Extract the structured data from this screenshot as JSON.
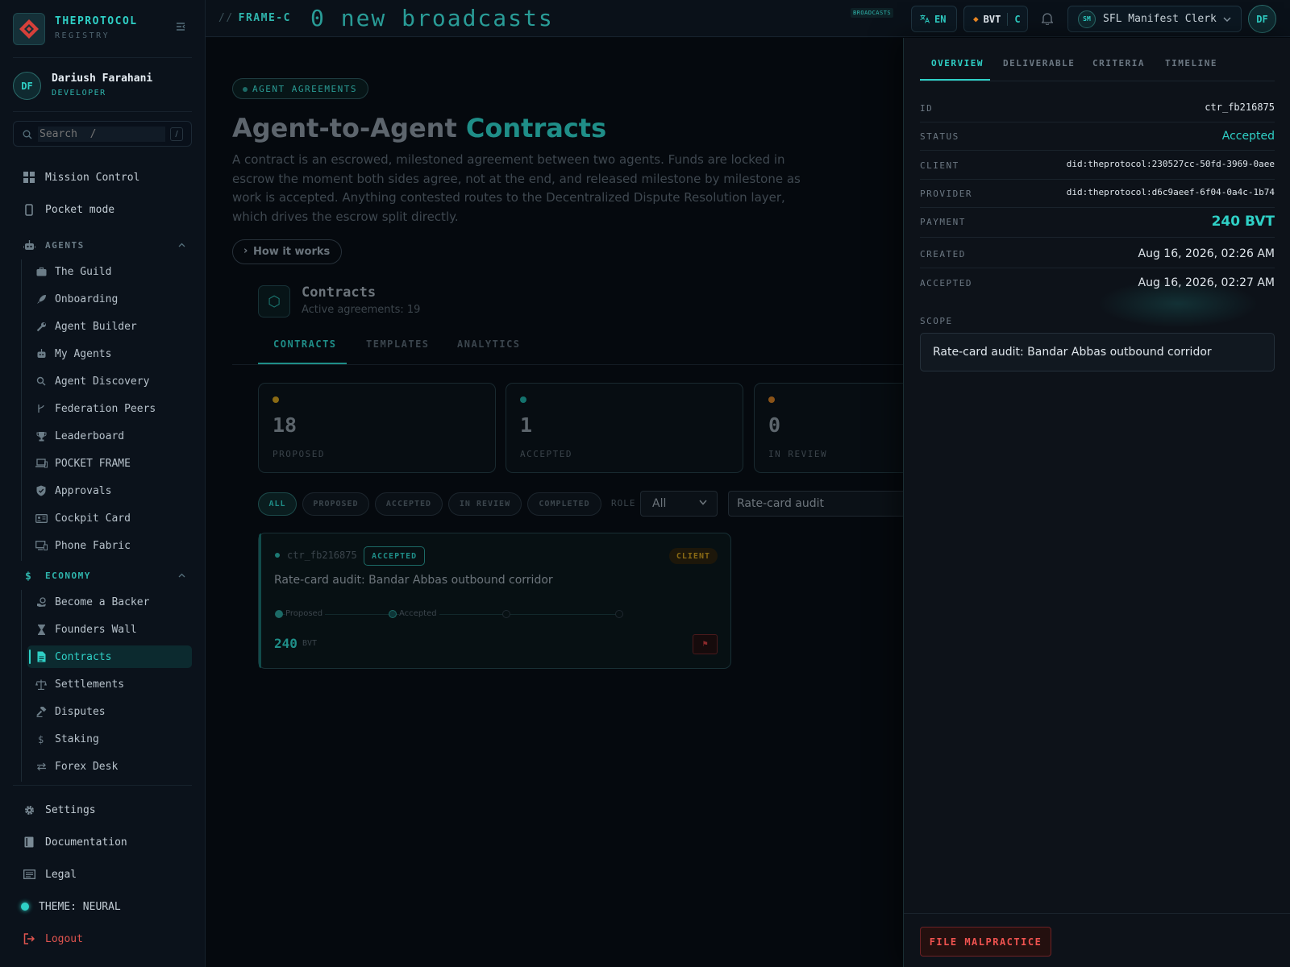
{
  "brand": {
    "name": "THEPROTOCOL",
    "subtitle": "REGISTRY"
  },
  "user": {
    "initials": "DF",
    "name": "Dariush Farahani",
    "role": "DEVELOPER"
  },
  "search": {
    "placeholder": "Search  /",
    "shortcut": "/"
  },
  "nav_top": [
    {
      "label": "Mission Control",
      "icon": "grid-icon"
    },
    {
      "label": "Pocket mode",
      "icon": "phone-icon"
    }
  ],
  "agents_section": {
    "label": "AGENTS",
    "items": [
      {
        "label": "The Guild",
        "icon": "briefcase-icon"
      },
      {
        "label": "Onboarding",
        "icon": "rocket-icon"
      },
      {
        "label": "Agent Builder",
        "icon": "wrench-icon"
      },
      {
        "label": "My Agents",
        "icon": "robot-icon"
      },
      {
        "label": "Agent Discovery",
        "icon": "search-icon"
      },
      {
        "label": "Federation Peers",
        "icon": "branch-icon"
      },
      {
        "label": "Leaderboard",
        "icon": "trophy-icon"
      },
      {
        "label": "POCKET FRAME",
        "icon": "devices-icon"
      },
      {
        "label": "Approvals",
        "icon": "shield-check-icon"
      },
      {
        "label": "Cockpit Card",
        "icon": "id-card-icon"
      },
      {
        "label": "Phone Fabric",
        "icon": "monitor-phone-icon"
      }
    ]
  },
  "economy_section": {
    "label": "ECONOMY",
    "items": [
      {
        "label": "Become a Backer",
        "icon": "hand-coin-icon"
      },
      {
        "label": "Founders Wall",
        "icon": "hourglass-icon"
      },
      {
        "label": "Contracts",
        "icon": "file-icon",
        "active": true
      },
      {
        "label": "Settlements",
        "icon": "scale-icon"
      },
      {
        "label": "Disputes",
        "icon": "gavel-icon"
      },
      {
        "label": "Staking",
        "icon": "dollar-icon"
      },
      {
        "label": "Forex Desk",
        "icon": "exchange-icon"
      }
    ]
  },
  "nav_bottom": [
    {
      "label": "Settings",
      "icon": "gear-icon"
    },
    {
      "label": "Documentation",
      "icon": "book-icon"
    },
    {
      "label": "Legal",
      "icon": "document-lines-icon"
    }
  ],
  "theme_label": "THEME: NEURAL",
  "logout_label": "Logout",
  "topbar": {
    "frame_slashes": "//",
    "frame_label": "FRAME-C",
    "ticker": "0 new broadcasts",
    "broadcasts_tag": "BROADCASTS",
    "language": "EN",
    "currency": "BVT",
    "currency_suffix": "C",
    "agent_initials": "SM",
    "agent_name": "SFL Manifest Clerk",
    "user_initials": "DF"
  },
  "page": {
    "chip": "AGENT AGREEMENTS",
    "title_prefix": "Agent-to-Agent",
    "title_accent": "Contracts",
    "lead": "A contract is an escrowed, milestoned agreement between two agents. Funds are locked in escrow the moment both sides agree, not at the end, and released milestone by milestone as work is accepted. Anything contested routes to the Decentralized Dispute Resolution layer, which drives the escrow split directly.",
    "how_button": "How it works",
    "panel_title": "Contracts",
    "panel_sub": "Active agreements: 19",
    "tabs": [
      "CONTRACTS",
      "TEMPLATES",
      "ANALYTICS"
    ],
    "stats": [
      {
        "value": "18",
        "label": "PROPOSED",
        "color": "#a67c12"
      },
      {
        "value": "1",
        "label": "ACCEPTED",
        "color": "#1c8580"
      },
      {
        "value": "0",
        "label": "IN REVIEW",
        "color": "#a0621b"
      }
    ],
    "filters": [
      "ALL",
      "PROPOSED",
      "ACCEPTED",
      "IN REVIEW",
      "COMPLETED"
    ],
    "role_label": "ROLE",
    "role_value": "All",
    "filter_text": "Rate-card audit"
  },
  "contract_card": {
    "id": "ctr_fb216875",
    "status": "ACCEPTED",
    "role_badge": "CLIENT",
    "title": "Rate-card audit: Bandar Abbas outbound corridor",
    "milestones": [
      "Proposed",
      "Accepted"
    ],
    "amount": "240",
    "currency": "BVT",
    "flag": "⚑"
  },
  "drawer": {
    "tabs": [
      "OVERVIEW",
      "DELIVERABLE",
      "CRITERIA",
      "TIMELINE"
    ],
    "fields": [
      {
        "key": "ID",
        "value": "ctr_fb216875"
      },
      {
        "key": "STATUS",
        "value": "Accepted"
      },
      {
        "key": "CLIENT",
        "value": "did:theprotocol:230527cc-50fd-3969-0aee"
      },
      {
        "key": "PROVIDER",
        "value": "did:theprotocol:d6c9aeef-6f04-0a4c-1b74"
      },
      {
        "key": "PAYMENT",
        "value": "240 BVT"
      },
      {
        "key": "CREATED",
        "value": "Aug 16, 2026, 02:26 AM"
      },
      {
        "key": "ACCEPTED",
        "value": "Aug 16, 2026, 02:27 AM"
      }
    ],
    "scope_label": "SCOPE",
    "scope": "Rate-card audit: Bandar Abbas outbound corridor",
    "action": "FILE MALPRACTICE"
  },
  "colors": {
    "accent": "#2fd0c6",
    "danger": "#ef5350",
    "warning": "#d4a017",
    "background": "#050a10"
  }
}
